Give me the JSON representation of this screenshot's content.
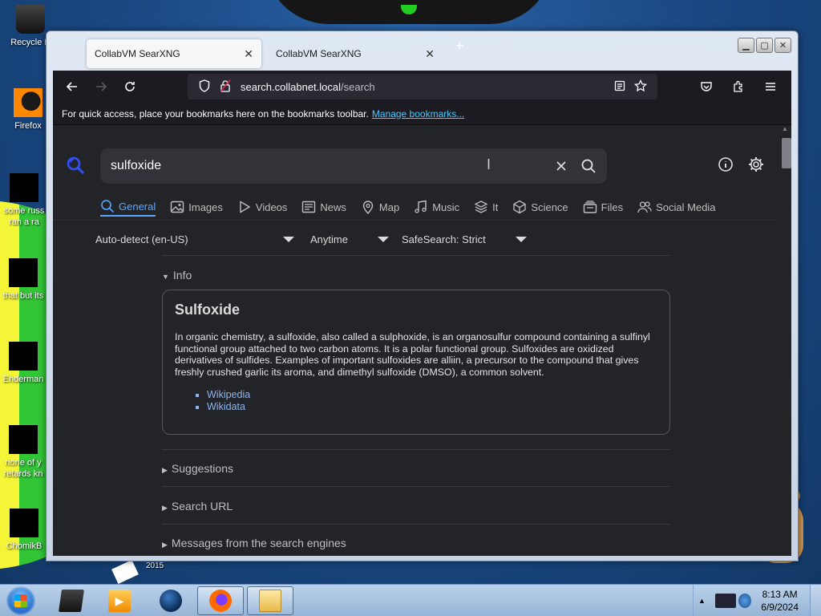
{
  "desktop": {
    "icons": [
      {
        "label": "Recycle B",
        "kind": "bin"
      },
      {
        "label": "Firefox",
        "kind": "fox"
      },
      {
        "label": "some russ ran a ra",
        "kind": "black"
      },
      {
        "label": "that but its",
        "kind": "black"
      },
      {
        "label": "Enderman",
        "kind": "black"
      },
      {
        "label": "none of y retards kn",
        "kind": "black"
      },
      {
        "label": "ChomikB",
        "kind": "black"
      }
    ],
    "date_label": "2015"
  },
  "browser": {
    "tabs": [
      {
        "title": "CollabVM SearXNG",
        "active": true
      },
      {
        "title": "CollabVM SearXNG",
        "active": false
      }
    ],
    "new_tab": "+",
    "url_host": "search.collabnet.local",
    "url_path": "/search",
    "bookmarks_text": "For quick access, place your bookmarks here on the bookmarks toolbar.",
    "bookmarks_link": "Manage bookmarks..."
  },
  "search": {
    "query": "sulfoxide",
    "categories": [
      {
        "label": "General",
        "icon": "search-icon",
        "active": true
      },
      {
        "label": "Images",
        "icon": "image-icon"
      },
      {
        "label": "Videos",
        "icon": "play-icon"
      },
      {
        "label": "News",
        "icon": "newspaper-icon"
      },
      {
        "label": "Map",
        "icon": "map-pin-icon"
      },
      {
        "label": "Music",
        "icon": "music-icon"
      },
      {
        "label": "It",
        "icon": "layers-icon"
      },
      {
        "label": "Science",
        "icon": "cube-icon"
      },
      {
        "label": "Files",
        "icon": "files-icon"
      },
      {
        "label": "Social Media",
        "icon": "people-icon"
      }
    ],
    "filters": {
      "language": "Auto-detect (en-US)",
      "time": "Anytime",
      "safesearch": "SafeSearch: Strict"
    },
    "info_label": "Info",
    "infobox": {
      "title": "Sulfoxide",
      "text": "In organic chemistry, a sulfoxide, also called a sulphoxide, is an organosulfur compound containing a sulfinyl functional group attached to two carbon atoms. It is a polar functional group. Sulfoxides are oxidized derivatives of sulfides. Examples of important sulfoxides are alliin, a precursor to the compound that gives freshly crushed garlic its aroma, and dimethyl sulfoxide (DMSO), a common solvent.",
      "links": [
        "Wikipedia",
        "Wikidata"
      ]
    },
    "sections": [
      "Suggestions",
      "Search URL",
      "Messages from the search engines"
    ]
  },
  "taskbar": {
    "time": "8:13 AM",
    "date": "6/9/2024"
  },
  "colors": {
    "accent": "#58a6ff",
    "page_bg": "#222428",
    "link": "#8fb4f0"
  }
}
